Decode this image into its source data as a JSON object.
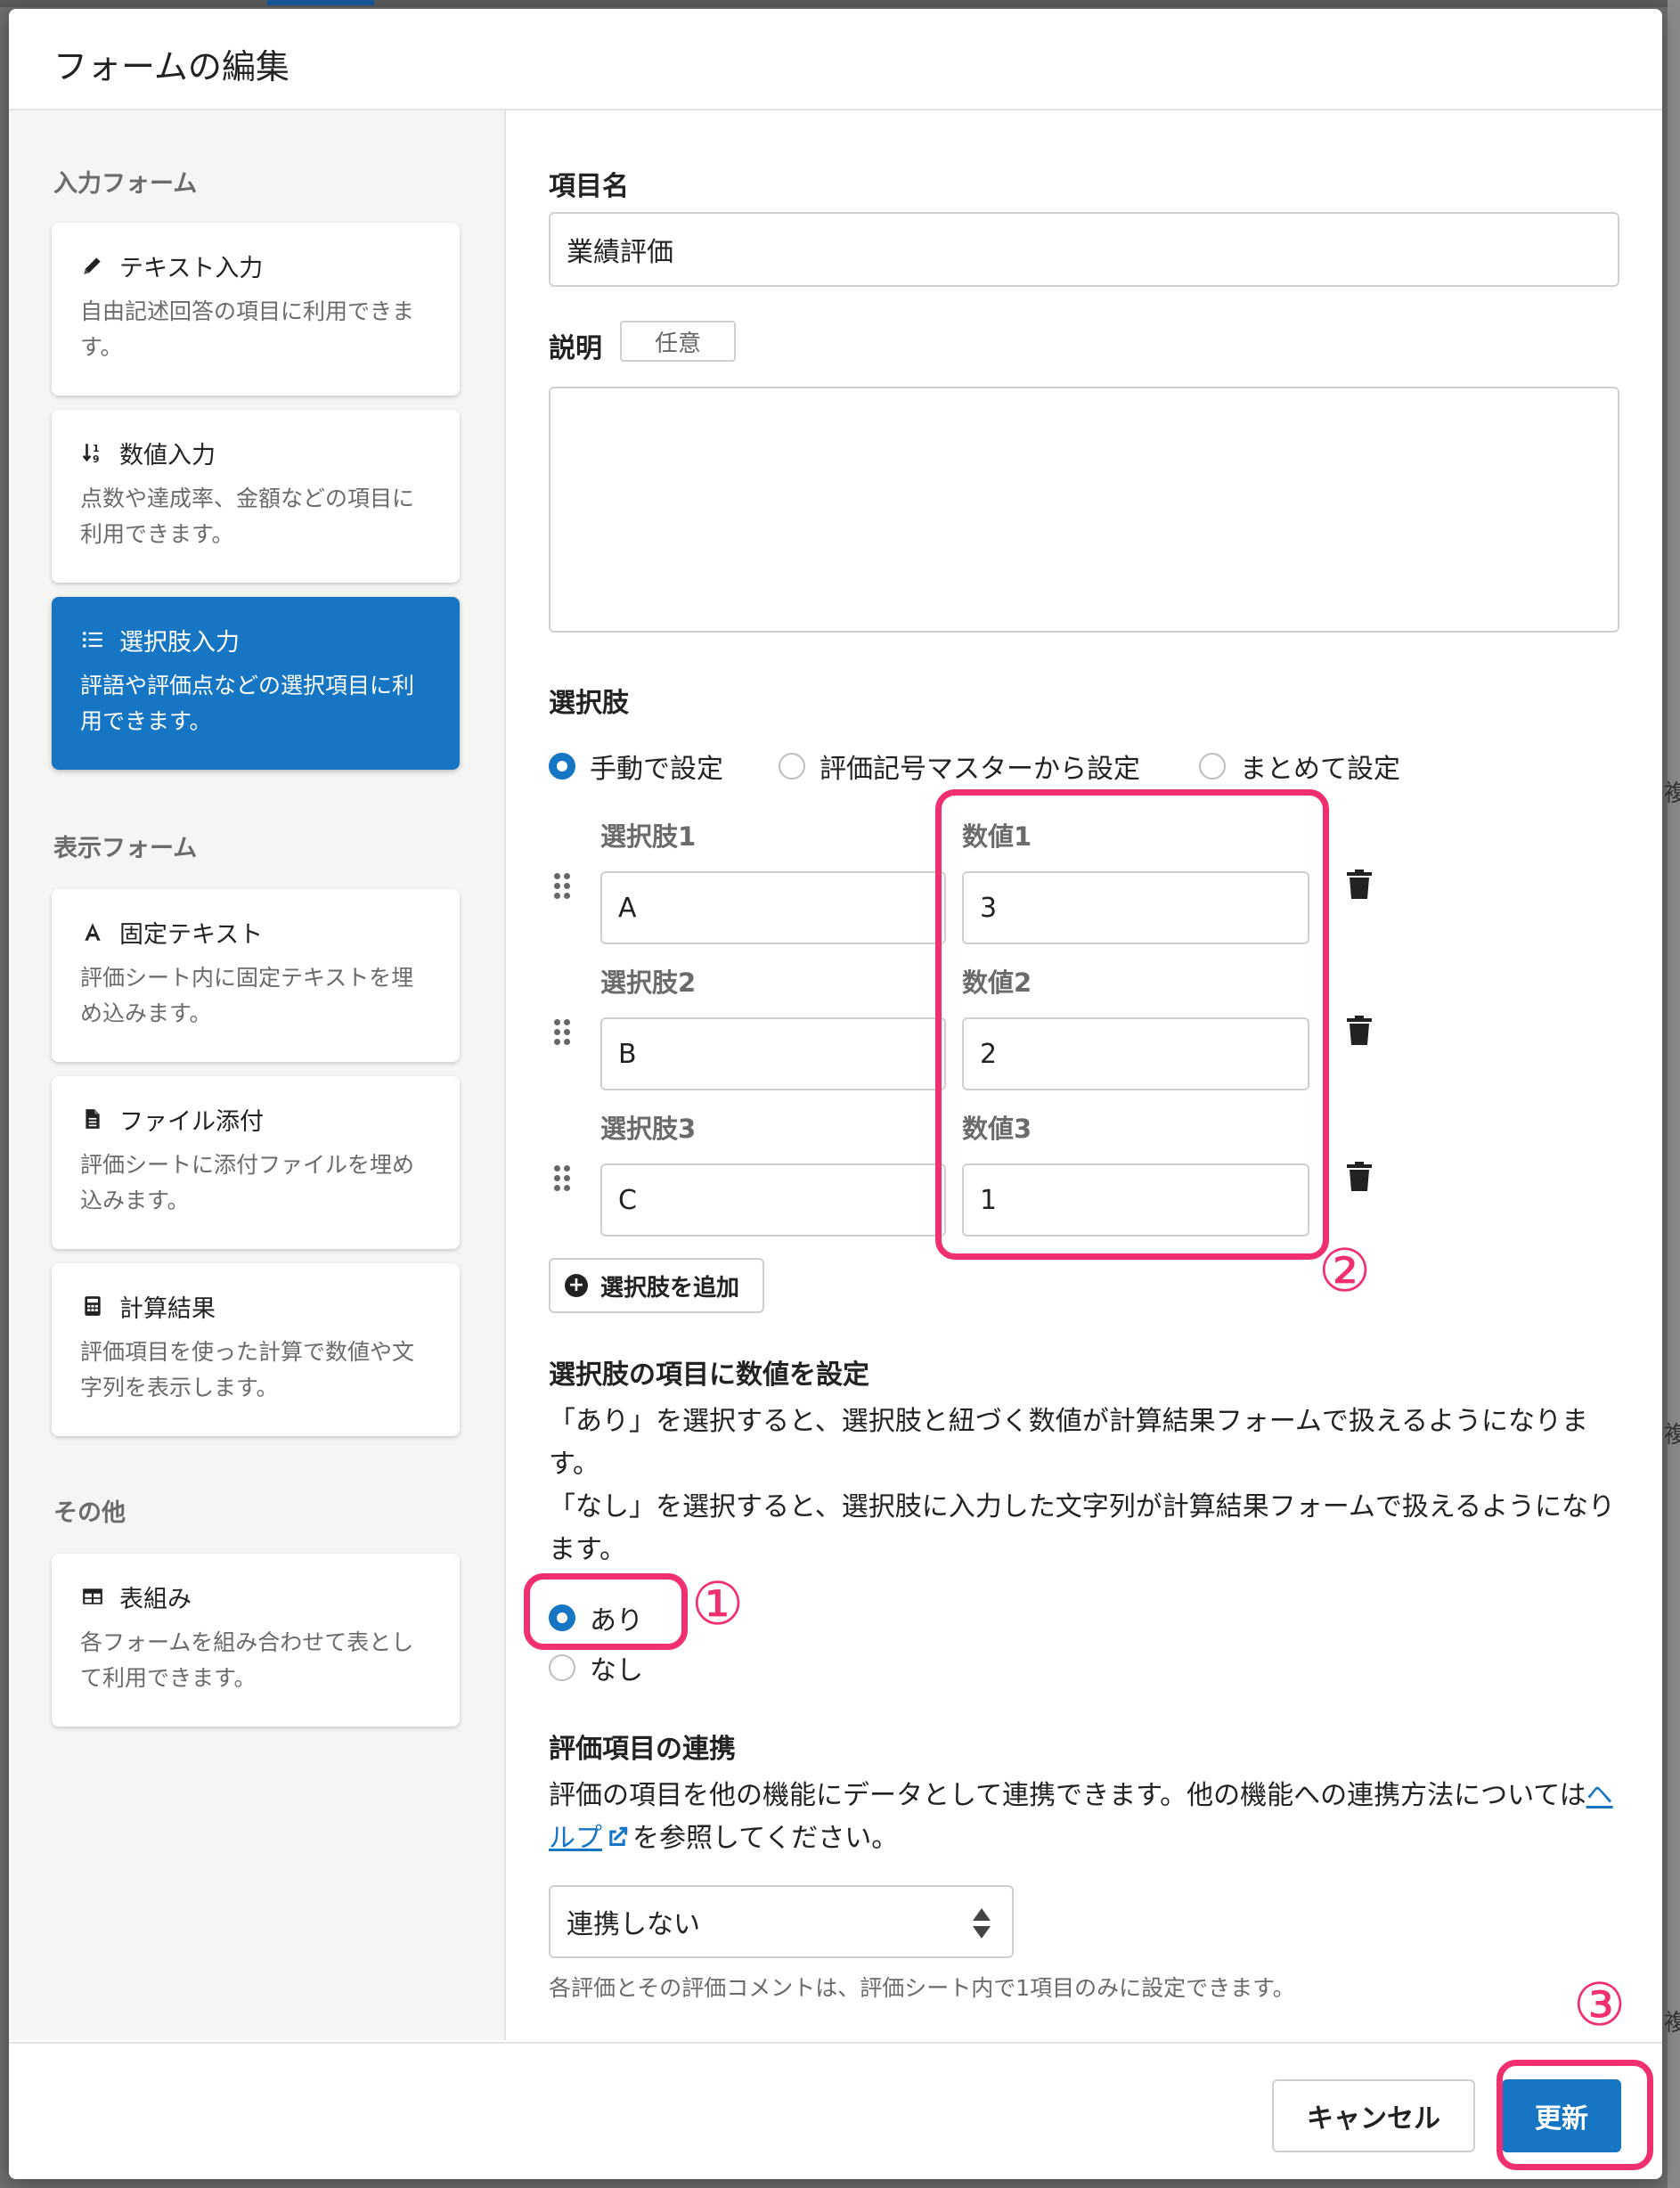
{
  "modal": {
    "title": "フォームの編集"
  },
  "sidebar": {
    "sections": [
      {
        "title": "入力フォーム",
        "items": [
          {
            "icon": "pencil-icon",
            "title": "テキスト入力",
            "desc": "自由記述回答の項目に利用できます。",
            "active": false
          },
          {
            "icon": "sort-numeric-icon",
            "title": "数値入力",
            "desc": "点数や達成率、金額などの項目に利用できます。",
            "active": false
          },
          {
            "icon": "list-icon",
            "title": "選択肢入力",
            "desc": "評語や評価点などの選択項目に利用できます。",
            "active": true
          }
        ]
      },
      {
        "title": "表示フォーム",
        "items": [
          {
            "icon": "font-icon",
            "title": "固定テキスト",
            "desc": "評価シート内に固定テキストを埋め込みます。",
            "active": false
          },
          {
            "icon": "file-icon",
            "title": "ファイル添付",
            "desc": "評価シートに添付ファイルを埋め込みます。",
            "active": false
          },
          {
            "icon": "calculator-icon",
            "title": "計算結果",
            "desc": "評価項目を使った計算で数値や文字列を表示します。",
            "active": false
          }
        ]
      },
      {
        "title": "その他",
        "items": [
          {
            "icon": "table-icon",
            "title": "表組み",
            "desc": "各フォームを組み合わせて表として利用できます。",
            "active": false
          }
        ]
      }
    ]
  },
  "main": {
    "item_name": {
      "label": "項目名",
      "value": "業績評価"
    },
    "description": {
      "label": "説明",
      "tag": "任意",
      "value": ""
    },
    "choices": {
      "label": "選択肢",
      "modes": [
        {
          "label": "手動で設定",
          "checked": true
        },
        {
          "label": "評価記号マスターから設定",
          "checked": false
        },
        {
          "label": "まとめて設定",
          "checked": false
        }
      ],
      "rows": [
        {
          "choice_label": "選択肢1",
          "choice_value": "A",
          "number_label": "数値1",
          "number_value": "3"
        },
        {
          "choice_label": "選択肢2",
          "choice_value": "B",
          "number_label": "数値2",
          "number_value": "2"
        },
        {
          "choice_label": "選択肢3",
          "choice_value": "C",
          "number_label": "数値3",
          "number_value": "1"
        }
      ],
      "add_label": "選択肢を追加"
    },
    "numeric_setting": {
      "title": "選択肢の項目に数値を設定",
      "desc_line1": "「あり」を選択すると、選択肢と紐づく数値が計算結果フォームで扱えるようになります。",
      "desc_line2": "「なし」を選択すると、選択肢に入力した文字列が計算結果フォームで扱えるようになります。",
      "options": [
        {
          "label": "あり",
          "checked": true
        },
        {
          "label": "なし",
          "checked": false
        }
      ]
    },
    "integration": {
      "title": "評価項目の連携",
      "desc_before": "評価の項目を他の機能にデータとして連携できます。他の機能への連携方法については",
      "link_text": "ヘルプ",
      "desc_after": "を参照してください。",
      "select_value": "連携しない",
      "note": "各評価とその評価コメントは、評価シート内で1項目のみに設定できます。"
    }
  },
  "footer": {
    "cancel_label": "キャンセル",
    "update_label": "更新"
  },
  "annotations": {
    "step1": "①",
    "step2": "②",
    "step3": "③",
    "highlight_color": "#f0306e"
  },
  "background": {
    "edge_texts": [
      "複",
      "複",
      "複"
    ]
  },
  "colors": {
    "primary": "#1676c4",
    "highlight": "#f0306e"
  }
}
